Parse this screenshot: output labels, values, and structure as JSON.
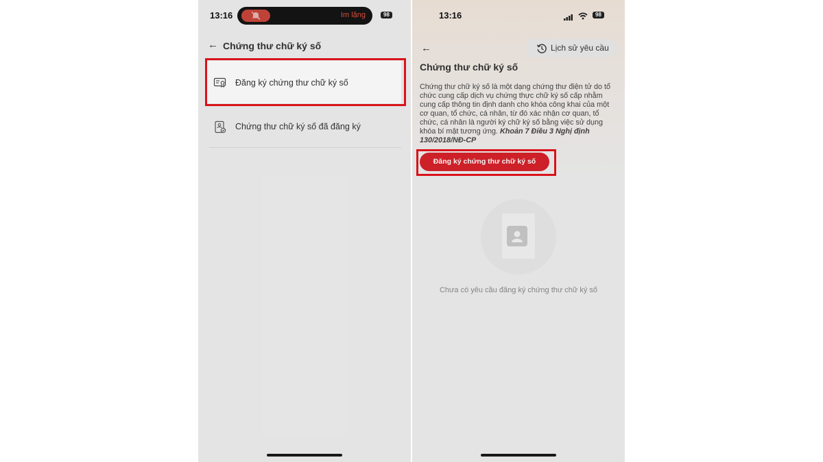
{
  "left_screen": {
    "status": {
      "time": "13:16",
      "silent_label": "Im lặng",
      "battery": "98"
    },
    "header": {
      "back_icon": "arrow-left-icon",
      "title": "Chứng thư chữ ký số"
    },
    "menu": [
      {
        "label": "Đăng ký chứng thư chữ ký số",
        "icon": "certificate-icon",
        "highlighted": true
      },
      {
        "label": "Chứng thư chữ ký số đã đăng ký",
        "icon": "registered-certificate-icon",
        "highlighted": false
      }
    ]
  },
  "right_screen": {
    "status": {
      "time": "13:16",
      "battery": "98"
    },
    "header": {
      "back_icon": "arrow-left-icon",
      "history_label": "Lịch sử yêu cầu",
      "history_icon": "history-icon"
    },
    "title": "Chứng thư chữ ký số",
    "description": "Chứng thư chữ ký số là một dạng chứng thư điện tử do tổ chức cung cấp dịch vụ chứng thực chữ ký số cấp nhằm cung cấp thông tin định danh cho khóa công khai của một cơ quan, tổ chức, cá nhân, từ đó xác nhận cơ quan, tổ chức, cá nhân là người ký chữ ký số bằng việc sử dụng khóa bí mật tương ứng.",
    "citation": "Khoản 7 Điều 3 Nghị định 130/2018/NĐ-CP",
    "register_button": "Đăng ký chứng thư chữ ký số",
    "empty_state": "Chưa có yêu cầu đăng ký chứng thư chữ ký số"
  },
  "colors": {
    "accent": "#d7222a",
    "highlight_border": "#e3131c"
  }
}
